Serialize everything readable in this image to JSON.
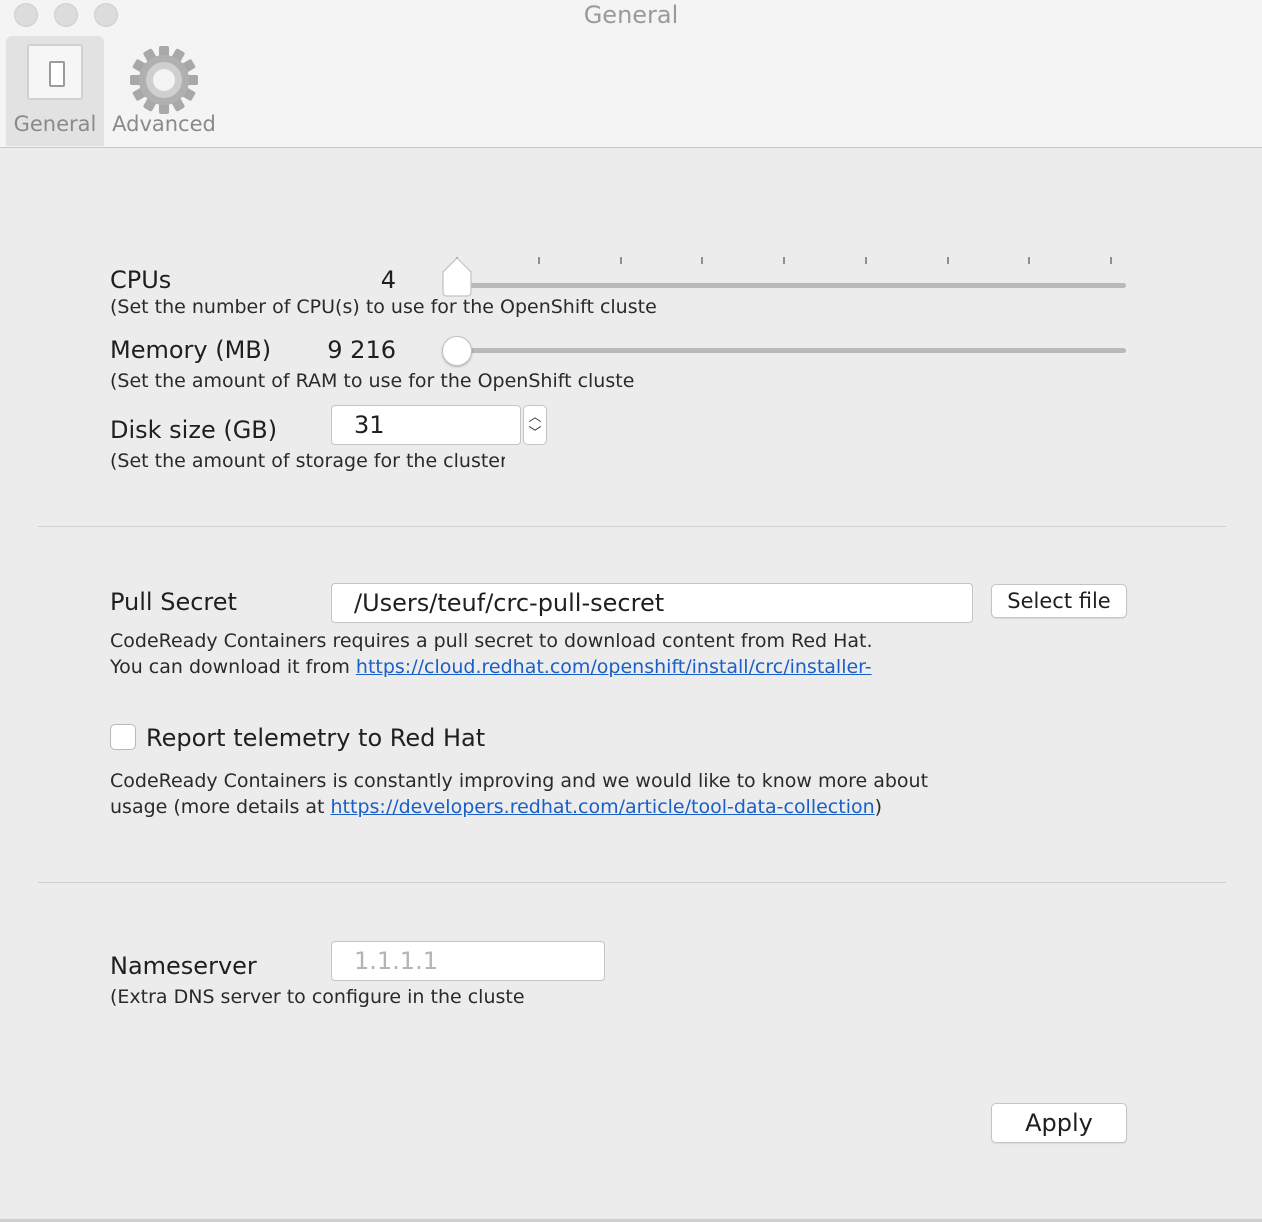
{
  "window": {
    "title": "General"
  },
  "toolbar": {
    "items": [
      {
        "label": "General",
        "icon": "switch-icon",
        "selected": true
      },
      {
        "label": "Advanced",
        "icon": "gear-icon",
        "selected": false
      }
    ]
  },
  "cpus": {
    "label": "CPUs",
    "value": "4",
    "hint": "(Set the number of CPU(s) to use for the OpenShift cluste",
    "slider_level": 0
  },
  "memory": {
    "label": "Memory (MB)",
    "value": "9 216",
    "hint": "(Set the amount of RAM to use for the OpenShift cluste",
    "slider_level": 0
  },
  "disk": {
    "label": "Disk size (GB)",
    "value": "31",
    "hint": "(Set the amount of storage for the cluster"
  },
  "pull_secret": {
    "label": "Pull Secret",
    "value": "/Users/teuf/crc-pull-secret",
    "select_button": "Select file",
    "desc_line1": "CodeReady Containers requires a pull secret to download content from Red Hat.",
    "desc_line2_prefix": "You can download it from ",
    "desc_link": "https://cloud.redhat.com/openshift/install/crc/installer-"
  },
  "telemetry": {
    "label": "Report telemetry to Red Hat",
    "checked": false,
    "desc_line1": "CodeReady Containers is constantly improving and we would like to know more about",
    "desc_line2_prefix": "usage (more details at ",
    "desc_link": "https://developers.redhat.com/article/tool-data-collection",
    "desc_line2_suffix": ")"
  },
  "nameserver": {
    "label": "Nameserver",
    "placeholder": "1.1.1.1",
    "hint": "(Extra DNS server to configure in the cluste"
  },
  "footer": {
    "apply_label": "Apply"
  }
}
